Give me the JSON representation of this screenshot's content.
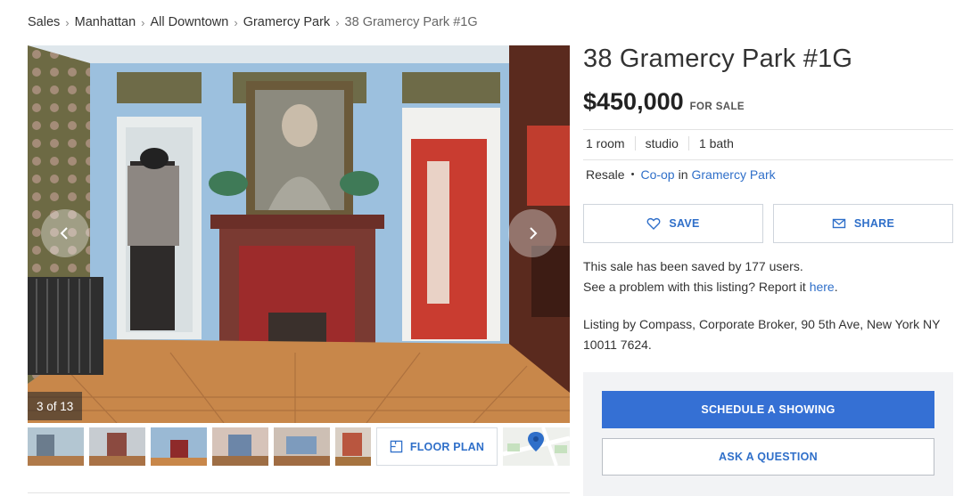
{
  "breadcrumb": {
    "items": [
      "Sales",
      "Manhattan",
      "All Downtown",
      "Gramercy Park"
    ],
    "current": "38 Gramercy Park #1G",
    "separator": "›"
  },
  "gallery": {
    "counter": "3 of 13",
    "prev_icon": "chevron-left-icon",
    "next_icon": "chevron-right-icon",
    "floor_plan_label": "FLOOR PLAN",
    "floor_plan_icon": "floor-plan-icon",
    "map_icon": "map-pin-icon"
  },
  "listing": {
    "title": "38 Gramercy Park #1G",
    "price": "$450,000",
    "status": "FOR SALE",
    "details": [
      "1 room",
      "studio",
      "1 bath"
    ],
    "sale_type": "Resale",
    "bullet": "•",
    "unit_type": "Co-op",
    "in_word": "in",
    "neighborhood": "Gramercy Park"
  },
  "actions": {
    "save_label": "SAVE",
    "save_icon": "heart-icon",
    "share_label": "SHARE",
    "share_icon": "envelope-icon"
  },
  "info": {
    "saved_text": "This sale has been saved by 177 users.",
    "problem_text": "See a problem with this listing? Report it",
    "problem_link": "here",
    "period": ".",
    "broker_text": "Listing by Compass, Corporate Broker, 90 5th Ave, New York NY 10011 7624."
  },
  "cta": {
    "schedule_label": "SCHEDULE A SHOWING",
    "ask_label": "ASK A QUESTION"
  },
  "colors": {
    "accent": "#2f6fc9",
    "primary_button": "#3570d4",
    "wall_blue": "#9cc0de",
    "floor_wood": "#c8874a",
    "fireplace_red": "#8e2a2a"
  }
}
